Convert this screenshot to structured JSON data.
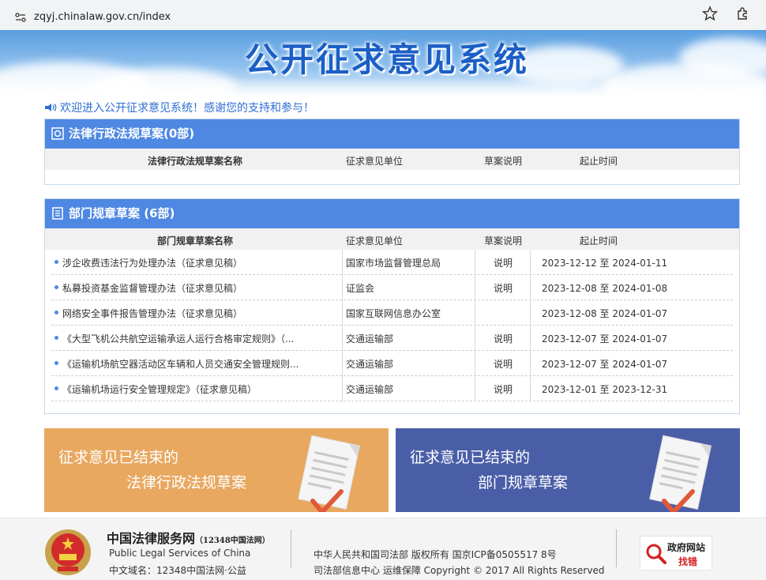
{
  "browser": {
    "url": "zqyj.chinalaw.gov.cn/index"
  },
  "banner": {
    "title": "公开征求意见系统"
  },
  "welcome": {
    "text": "欢迎进入公开征求意见系统！感谢您的支持和参与！"
  },
  "law_panel": {
    "title": "法律行政法规草案(0部)",
    "columns": [
      "法律行政法规草案名称",
      "征求意见单位",
      "草案说明",
      "起止时间"
    ]
  },
  "dept_panel": {
    "title": "部门规章草案 (6部)",
    "columns": [
      "部门规章草案名称",
      "征求意见单位",
      "草案说明",
      "起止时间"
    ],
    "rows": [
      {
        "name": "涉企收费违法行为处理办法（征求意见稿）",
        "unit": "国家市场监督管理总局",
        "note": "说明",
        "period": "2023-12-12 至 2024-01-11"
      },
      {
        "name": "私募投资基金监督管理办法（征求意见稿）",
        "unit": "证监会",
        "note": "说明",
        "period": "2023-12-08 至 2024-01-08"
      },
      {
        "name": "网络安全事件报告管理办法（征求意见稿）",
        "unit": "国家互联网信息办公室",
        "note": "",
        "period": "2023-12-08 至 2024-01-07"
      },
      {
        "name": "《大型飞机公共航空运输承运人运行合格审定规则》（...",
        "unit": "交通运输部",
        "note": "说明",
        "period": "2023-12-07 至 2024-01-07"
      },
      {
        "name": "《运输机场航空器活动区车辆和人员交通安全管理规则...",
        "unit": "交通运输部",
        "note": "说明",
        "period": "2023-12-07 至 2024-01-07"
      },
      {
        "name": "《运输机场运行安全管理规定》（征求意见稿）",
        "unit": "交通运输部",
        "note": "说明",
        "period": "2023-12-01 至 2023-12-31"
      }
    ]
  },
  "tiles": [
    {
      "line1": "征求意见已结束的",
      "line2": "法律行政法规草案",
      "color": "#e8a860"
    },
    {
      "line1": "征求意见已结束的",
      "line2": "部门规章草案",
      "color": "#4a5ea8"
    }
  ],
  "footer": {
    "brand": "中国法律服务网",
    "brand_note": "（12348中国法网）",
    "english": "Public Legal Services of China",
    "domain": "中文域名：12348中国法网·公益",
    "copyright1": "中华人民共和国司法部 版权所有 国京ICP备0505517 8号",
    "copyright2": "司法部信息中心 运维保障 Copyright © 2017 All Rights Reserved",
    "gov_badge_1": "政府网站",
    "gov_badge_2": "找错"
  },
  "colors": {
    "accent": "#4e88e3",
    "title_blue": "#1b5fc6",
    "tile_orange": "#e8a860",
    "tile_blue": "#4a5ea8"
  }
}
